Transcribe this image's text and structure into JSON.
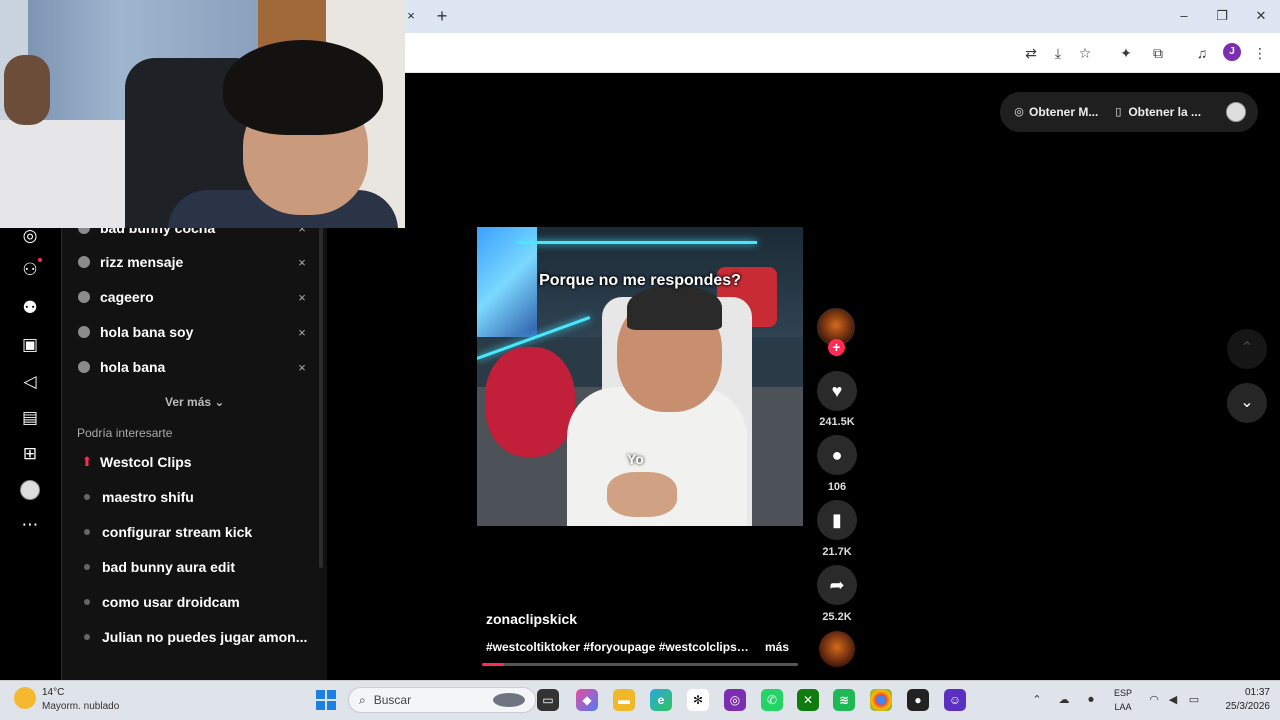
{
  "browser": {
    "tab_close": "×",
    "new_tab": "+",
    "win_minimize": "–",
    "win_restore": "❐",
    "win_close": "✕",
    "profile_initial": "J"
  },
  "header": {
    "get_app_label": "Obtener M...",
    "get_app2_label": "Obtener la ..."
  },
  "search_history": {
    "items": [
      {
        "label": "bad bunny cocha"
      },
      {
        "label": "rizz mensaje"
      },
      {
        "label": "cageero"
      },
      {
        "label": "hola bana soy"
      },
      {
        "label": "hola bana"
      }
    ],
    "remove_glyph": "×",
    "see_more": "Ver más ⌄"
  },
  "suggestions": {
    "title": "Podría interesarte",
    "items": [
      {
        "label": "Westcol Clips",
        "trending": true
      },
      {
        "label": "maestro shifu"
      },
      {
        "label": "configurar stream kick"
      },
      {
        "label": "bad bunny aura edit"
      },
      {
        "label": "como usar droidcam"
      },
      {
        "label": "Julian no puedes jugar amon..."
      }
    ],
    "trending_glyph": "⬆"
  },
  "video": {
    "caption": "Porque no me responde͏s?",
    "overlay_text": "Yo",
    "author": "zonaclipskick",
    "hashtags": "#westcoltiktoker #foryoupage #westcolclips ...",
    "more": "más",
    "progress": 0.07
  },
  "actions": {
    "follow_plus": "+",
    "likes": "241.5K",
    "comments": "106",
    "saves": "21.7K",
    "shares": "25.2K"
  },
  "taskbar": {
    "temperature": "14°C",
    "weather": "Mayorm. nublado",
    "search_label": "Buscar",
    "lang_top": "ESP",
    "lang_bottom": "LAA",
    "time": "01:37",
    "date": "25/3/2026"
  },
  "colors": {
    "accent": "#fe2c55",
    "panel_bg": "#121212",
    "taskbar_bg": "#dfe3ea"
  }
}
